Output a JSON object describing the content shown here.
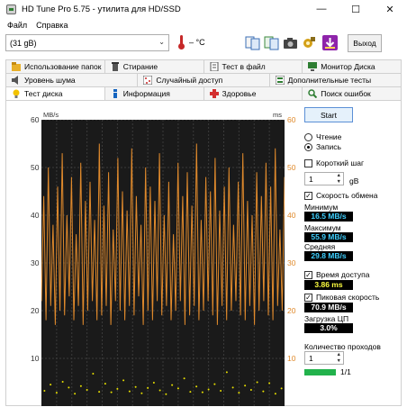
{
  "window": {
    "title": "HD Tune Pro 5.75 - утилита для HD/SSD",
    "minimize": "—",
    "maximize": "☐",
    "close": "✕"
  },
  "menu": {
    "file": "Файл",
    "help": "Справка"
  },
  "toolbar": {
    "drive": "(31 gB)",
    "temperature": "– °C",
    "exit_label": "Выход"
  },
  "tabs": {
    "row1": [
      "Использование папок",
      "Стирание",
      "Тест в файл",
      "Монитор Диска"
    ],
    "row2": [
      "Уровень шума",
      "Случайный доступ",
      "Дополнительные тесты"
    ],
    "row3": [
      "Тест диска",
      "Информация",
      "Здоровье",
      "Поиск ошибок"
    ]
  },
  "chart": {
    "left_unit": "MB/s",
    "right_unit": "ms",
    "left_ticks": [
      "60",
      "50",
      "40",
      "30",
      "20",
      "10"
    ],
    "right_ticks": [
      "60",
      "50",
      "40",
      "30",
      "20",
      "10"
    ],
    "x_tick_count": 16
  },
  "panel": {
    "start_label": "Start",
    "read_label": "Чтение",
    "write_label": "Запись",
    "read_selected": false,
    "write_selected": true,
    "short_stroke_label": "Короткий шаг",
    "short_stroke_checked": false,
    "short_stroke_value": "1",
    "short_stroke_unit": "gB",
    "transfer_rate_label": "Скорость обмена",
    "transfer_rate_checked": true,
    "minimum_label": "Минимум",
    "minimum_value": "16.5 MB/s",
    "maximum_label": "Максимум",
    "maximum_value": "55.9 MB/s",
    "average_label": "Средняя",
    "average_value": "29.8 MB/s",
    "access_time_label": "Время доступа",
    "access_time_checked": true,
    "access_time_value": "3.86 ms",
    "burst_rate_label": "Пиковая скорость",
    "burst_rate_checked": true,
    "burst_rate_value": "70.9 MB/s",
    "cpu_usage_label": "Загрузка ЦП",
    "cpu_usage_value": "3.0%",
    "passes_label": "Количество проходов",
    "passes_value": "1",
    "progress_text": "1/1",
    "progress_fraction": 1.0
  },
  "colors": {
    "chart_bg": "#1a1a1a",
    "transfer_line": "#e08a2c",
    "access_points": "#e8e000",
    "value_cyan": "#3fd0ff",
    "value_yellow": "#ffff40",
    "value_white": "#ffffff",
    "progress_green": "#22b24c"
  },
  "chart_data": {
    "type": "line",
    "title": "",
    "xlabel": "",
    "ylabel": "MB/s",
    "y2label": "ms",
    "ylim": [
      0,
      60
    ],
    "y2lim": [
      0,
      60
    ],
    "grid": true,
    "series": [
      {
        "name": "Скорость обмена",
        "axis": "left",
        "values": [
          22,
          44,
          18,
          50,
          21,
          38,
          17,
          46,
          20,
          53,
          19,
          40,
          23,
          48,
          18,
          36,
          21,
          51,
          17,
          43,
          20,
          47,
          22,
          39,
          18,
          55,
          19,
          42,
          21,
          49,
          17,
          37,
          22,
          52,
          20,
          45,
          18,
          41,
          21,
          54,
          19,
          44,
          23,
          38,
          17,
          50,
          20,
          46,
          18,
          43,
          22,
          53,
          19,
          40,
          21,
          47,
          18,
          36,
          20,
          51,
          22,
          44,
          17,
          49,
          19,
          42,
          21,
          55,
          18,
          39,
          20,
          48,
          22,
          45,
          19,
          52,
          17,
          41,
          21,
          46,
          18,
          50,
          20,
          38,
          22,
          47,
          19,
          53,
          18,
          43,
          21,
          40,
          17,
          49,
          20,
          44,
          22,
          51,
          19,
          46,
          18,
          54,
          21,
          37,
          20,
          48
        ]
      },
      {
        "name": "Время доступа",
        "axis": "right",
        "values": [
          3.2,
          4.5,
          2.8,
          5.1,
          3.9,
          2.6,
          4.2,
          3.4,
          6.8,
          3.0,
          4.7,
          2.9,
          3.6,
          5.4,
          3.1,
          4.0,
          2.7,
          3.8,
          4.9,
          3.3,
          2.5,
          4.4,
          3.7,
          5.8,
          3.0,
          4.1,
          2.9,
          3.5,
          4.6,
          3.2,
          7.1,
          3.9,
          2.8,
          4.3,
          3.4,
          5.0,
          3.1,
          4.8,
          2.6,
          3.7
        ]
      }
    ]
  }
}
